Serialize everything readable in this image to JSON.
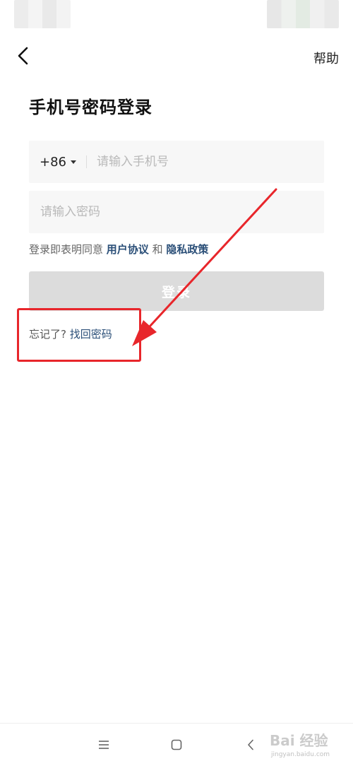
{
  "header": {
    "help_label": "帮助"
  },
  "page": {
    "title": "手机号密码登录"
  },
  "phone": {
    "country_code": "+86",
    "placeholder": "请输入手机号"
  },
  "password": {
    "placeholder": "请输入密码"
  },
  "agreement": {
    "prefix": "登录即表明同意",
    "user_agreement": "用户协议",
    "conjunction": "和",
    "privacy_policy": "隐私政策"
  },
  "login": {
    "label": "登录"
  },
  "forgot": {
    "prefix": "忘记了?",
    "link": "找回密码"
  },
  "watermark": {
    "brand": "Bai 经验",
    "url": "jingyan.baidu.com"
  },
  "colors": {
    "link": "#2b4f78",
    "annotation": "#e8262b",
    "button_disabled": "#dcdcdc"
  },
  "icons": {
    "back": "chevron-left-icon",
    "country_dropdown": "caret-down-icon",
    "nav_menu": "menu-icon",
    "nav_home": "square-home-icon",
    "nav_back": "chevron-left-icon"
  }
}
